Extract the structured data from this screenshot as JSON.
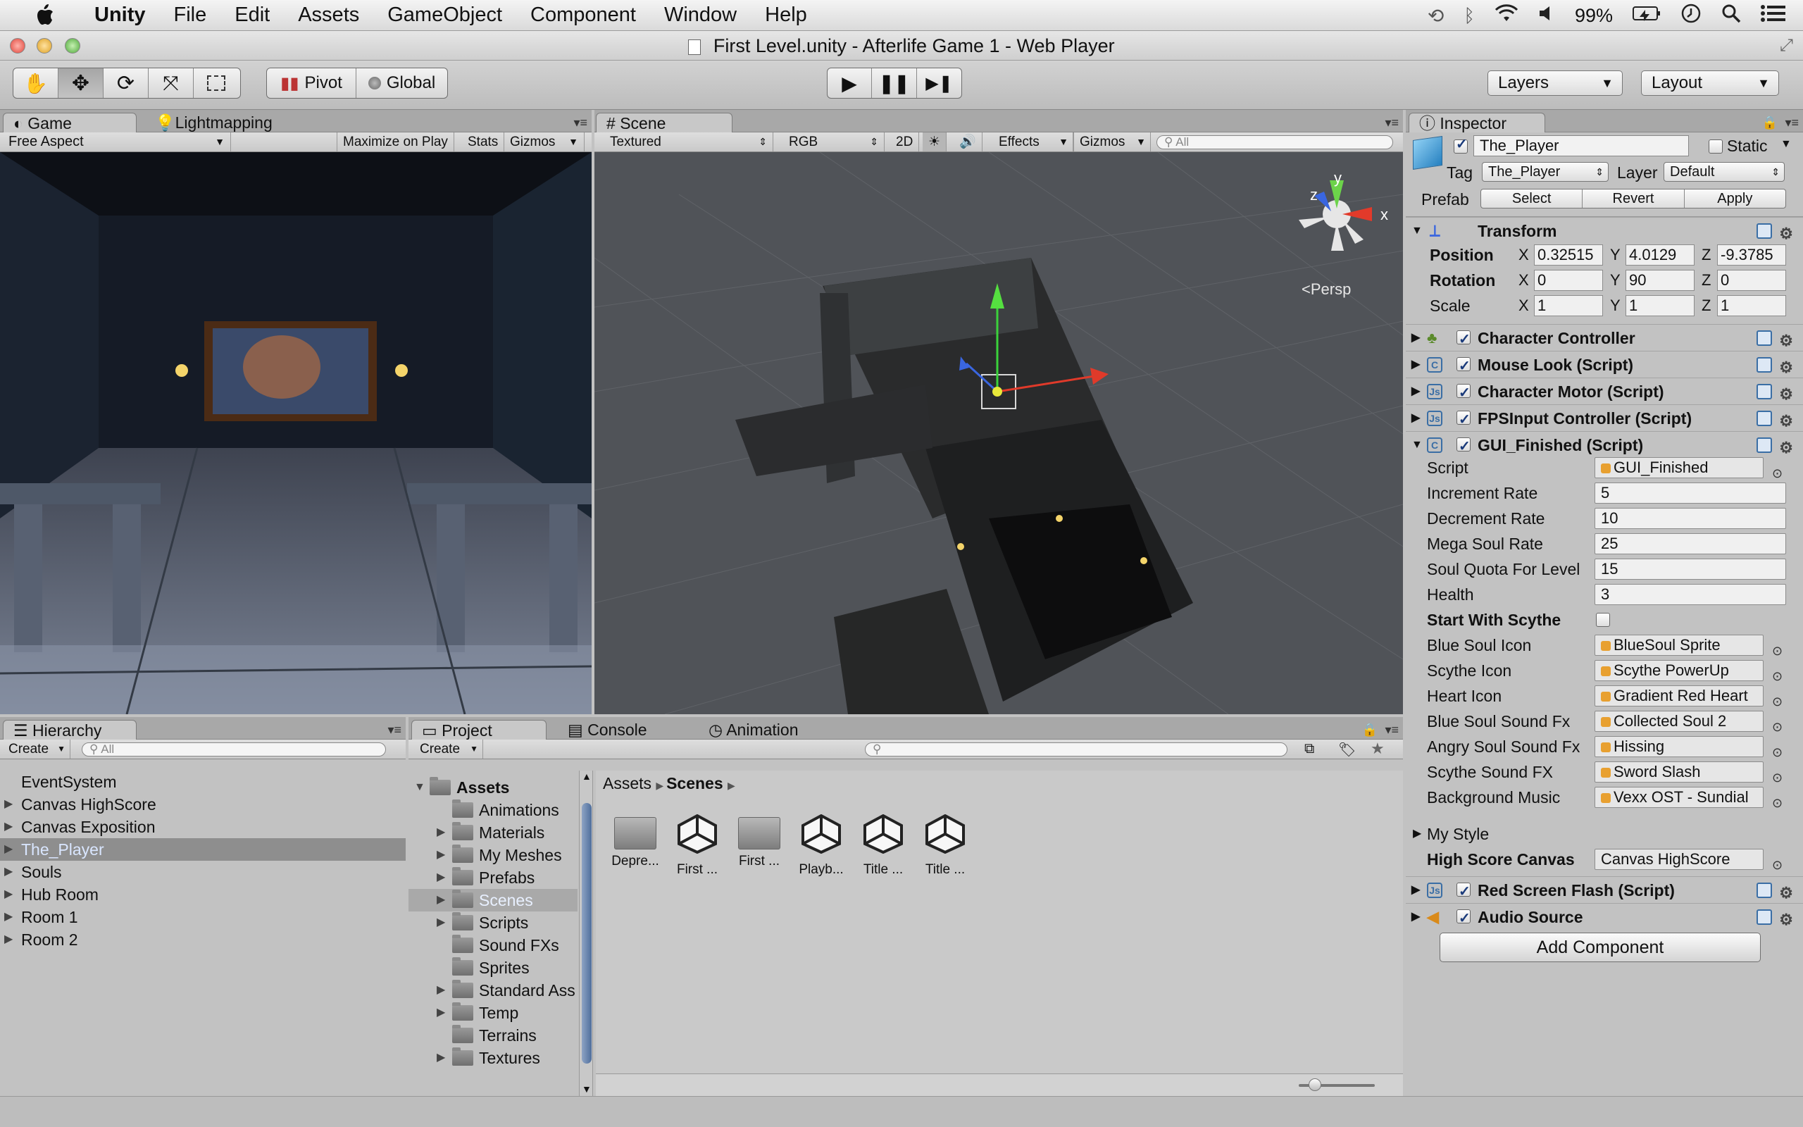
{
  "menubar": {
    "app": "Unity",
    "items": [
      "File",
      "Edit",
      "Assets",
      "GameObject",
      "Component",
      "Window",
      "Help"
    ],
    "battery": "99%"
  },
  "window": {
    "title": "First Level.unity - Afterlife Game 1 - Web Player"
  },
  "toolbar": {
    "pivot": "Pivot",
    "global": "Global",
    "layers": "Layers",
    "layout": "Layout"
  },
  "game": {
    "tab": "Game",
    "tab2": "Lightmapping",
    "aspect": "Free Aspect",
    "maximize": "Maximize on Play",
    "stats": "Stats",
    "gizmos": "Gizmos"
  },
  "scene": {
    "tab": "Scene",
    "shading": "Textured",
    "rgb": "RGB",
    "twod": "2D",
    "effects": "Effects",
    "gizmos": "Gizmos",
    "search_placeholder": "All",
    "persp": "Persp",
    "axis_x": "x",
    "axis_y": "y",
    "axis_z": "z"
  },
  "hierarchy": {
    "tab": "Hierarchy",
    "create": "Create",
    "search_placeholder": "All",
    "items": [
      {
        "label": "EventSystem",
        "expandable": false
      },
      {
        "label": "Canvas HighScore",
        "expandable": true
      },
      {
        "label": "Canvas Exposition",
        "expandable": true
      },
      {
        "label": "The_Player",
        "expandable": true,
        "selected": true
      },
      {
        "label": "Souls",
        "expandable": true
      },
      {
        "label": "Hub Room",
        "expandable": true
      },
      {
        "label": "Room 1",
        "expandable": true
      },
      {
        "label": "Room 2",
        "expandable": true
      }
    ]
  },
  "project": {
    "tab": "Project",
    "tab_console": "Console",
    "tab_animation": "Animation",
    "create": "Create",
    "tree": [
      {
        "label": "Assets",
        "level": 0,
        "expandable": true,
        "bold": true
      },
      {
        "label": "Animations",
        "level": 1,
        "expandable": false
      },
      {
        "label": "Materials",
        "level": 1,
        "expandable": true
      },
      {
        "label": "My Meshes",
        "level": 1,
        "expandable": true
      },
      {
        "label": "Prefabs",
        "level": 1,
        "expandable": true
      },
      {
        "label": "Scenes",
        "level": 1,
        "expandable": true,
        "selected": true
      },
      {
        "label": "Scripts",
        "level": 1,
        "expandable": true
      },
      {
        "label": "Sound FXs",
        "level": 1,
        "expandable": false
      },
      {
        "label": "Sprites",
        "level": 1,
        "expandable": false
      },
      {
        "label": "Standard Ass",
        "level": 1,
        "expandable": true
      },
      {
        "label": "Temp",
        "level": 1,
        "expandable": true
      },
      {
        "label": "Terrains",
        "level": 1,
        "expandable": false
      },
      {
        "label": "Textures",
        "level": 1,
        "expandable": true
      }
    ],
    "breadcrumb": [
      "Assets",
      "Scenes"
    ],
    "files": [
      {
        "label": "Depre...",
        "kind": "folder"
      },
      {
        "label": "First ...",
        "kind": "unity"
      },
      {
        "label": "First ...",
        "kind": "folder"
      },
      {
        "label": "Playb...",
        "kind": "unity"
      },
      {
        "label": "Title ...",
        "kind": "unity"
      },
      {
        "label": "Title ...",
        "kind": "unity"
      }
    ]
  },
  "inspector": {
    "tab": "Inspector",
    "object_name": "The_Player",
    "static": "Static",
    "tag_label": "Tag",
    "tag_value": "The_Player",
    "layer_label": "Layer",
    "layer_value": "Default",
    "prefab_label": "Prefab",
    "prefab_select": "Select",
    "prefab_revert": "Revert",
    "prefab_apply": "Apply",
    "transform": {
      "title": "Transform",
      "position_label": "Position",
      "rotation_label": "Rotation",
      "scale_label": "Scale",
      "position": [
        "0.32515",
        "4.0129",
        "-9.3785"
      ],
      "rotation": [
        "0",
        "90",
        "0"
      ],
      "scale": [
        "1",
        "1",
        "1"
      ]
    },
    "components": [
      "Character Controller",
      "Mouse Look (Script)",
      "Character Motor (Script)",
      "FPSInput Controller (Script)",
      "GUI_Finished (Script)"
    ],
    "gui_fields": [
      {
        "label": "Script",
        "value": "GUI_Finished",
        "obj": true
      },
      {
        "label": "Increment Rate",
        "value": "5"
      },
      {
        "label": "Decrement Rate",
        "value": "10"
      },
      {
        "label": "Mega Soul Rate",
        "value": "25"
      },
      {
        "label": "Soul Quota For Level",
        "value": "15"
      },
      {
        "label": "Health",
        "value": "3"
      },
      {
        "label": "Start With Scythe",
        "value": "",
        "checkbox": true,
        "bold": true
      },
      {
        "label": "Blue Soul Icon",
        "value": "BlueSoul Sprite",
        "obj": true
      },
      {
        "label": "Scythe Icon",
        "value": "Scythe PowerUp",
        "obj": true
      },
      {
        "label": "Heart Icon",
        "value": "Gradient Red Heart",
        "obj": true
      },
      {
        "label": "Blue Soul Sound Fx",
        "value": "Collected Soul 2",
        "obj": true
      },
      {
        "label": "Angry Soul Sound Fx",
        "value": "Hissing",
        "obj": true
      },
      {
        "label": "Scythe Sound FX",
        "value": "Sword Slash",
        "obj": true
      },
      {
        "label": "Background Music",
        "value": "Vexx OST - Sundial",
        "obj": true
      }
    ],
    "my_style": "My Style",
    "high_score_label": "High Score Canvas",
    "high_score_value": "Canvas HighScore",
    "red_flash": "Red Screen Flash (Script)",
    "audio_source": "Audio Source",
    "add_component": "Add Component"
  }
}
